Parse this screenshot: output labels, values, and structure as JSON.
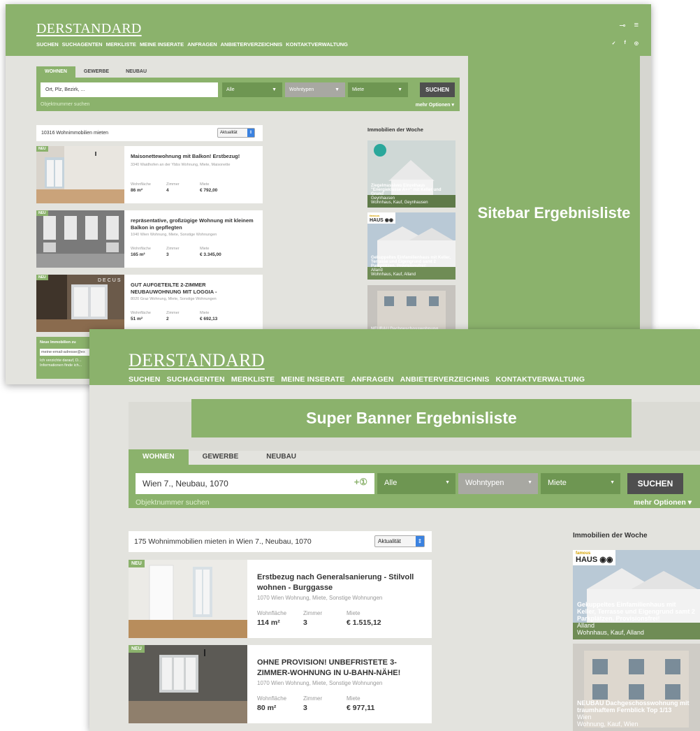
{
  "brand": {
    "logo": "DERSTANDARD",
    "nav": [
      "SUCHEN",
      "SUCHAGENTEN",
      "MERKLISTE",
      "MEINE INSERATE",
      "ANFRAGEN",
      "ANBIETERVERZEICHNIS",
      "KONTAKTVERWALTUNG"
    ],
    "accent": "#8bb26c"
  },
  "shot1": {
    "tabs": [
      "WOHNEN",
      "GEWERBE",
      "NEUBAU"
    ],
    "search_placeholder": "Ort, Plz, Bezirk, ...",
    "filters": [
      "Alle",
      "Wohntypen",
      "Miete"
    ],
    "search_button": "SUCHEN",
    "object_link": "Objektnummer suchen",
    "more_options": "mehr Optionen ▾",
    "count": "10316 Wohnimmobilien mieten",
    "sort": "Aktualität",
    "sitebar_label": "Sitebar Ergebnisliste",
    "right_title": "Immobilien der Woche",
    "listings": [
      {
        "badge": "NEU",
        "title": "Maisonettewohnung mit Balkon! Erstbezug!",
        "sub": "3340 Waidhofen an der Ybbs Wohnung, Miete, Maisonette",
        "area_label": "Wohnfläche",
        "area": "86 m²",
        "rooms_label": "Zimmer",
        "rooms": "4",
        "rent_label": "Miete",
        "rent": "€ 792,00"
      },
      {
        "badge": "NEU",
        "title": "repräsentative, großzügige Wohnung mit kleinem Balkon in gepflegten",
        "sub": "1040 Wien Wohnung, Miete, Sonstige Wohnungen",
        "area_label": "Wohnfläche",
        "area": "165 m²",
        "rooms_label": "Zimmer",
        "rooms": "3",
        "rent_label": "Miete",
        "rent": "€ 3.345,00"
      },
      {
        "badge": "NEU",
        "title": "GUT AUFGETEILTE 2-ZIMMER NEUBAUWOHNUNG MIT LOGGIA -",
        "sub": "8020 Graz Wohnung, Miete, Sonstige Wohnungen",
        "area_label": "Wohnfläche",
        "area": "51 m²",
        "rooms_label": "Zimmer",
        "rooms": "2",
        "rent_label": "Miete",
        "rent": "€ 692,13",
        "thumb_text": "DECUS"
      }
    ],
    "featured": [
      {
        "title": "Ziegelmassives Einzelhaus \"Energieklasse A++\" mit Keller und Grund",
        "loc": "Geynhausen",
        "type": "Wohnhaus, Kauf, Geynhausen"
      },
      {
        "logo": "HAUS",
        "logo_top": "famous",
        "title": "Gekuppeltes Einfamilienhaus mit Keller, Terrasse und Eigengrund samt 2 Parkplätzen. Provisionsfrei!",
        "loc": "Alland",
        "type": "Wohnhaus, Kauf, Alland"
      },
      {
        "title": "NEUBAU Dachgeschosswohnung",
        "loc": "",
        "type": ""
      }
    ],
    "newsletter": {
      "title": "Neue Immobilien zu",
      "email": "meine-email-adresse@ex",
      "consent": "Ich verzichte darauf, D... Informationen finde ich..."
    }
  },
  "shot2": {
    "banner": "Super Banner Ergebnisliste",
    "tabs": [
      "WOHNEN",
      "GEWERBE",
      "NEUBAU"
    ],
    "search_value": "Wien 7., Neubau, 1070",
    "search_plus": "+①",
    "filters": [
      "Alle",
      "Wohntypen",
      "Miete"
    ],
    "search_button": "SUCHEN",
    "object_link": "Objektnummer suchen",
    "more_options": "mehr Optionen ▾",
    "count": "175 Wohnimmobilien mieten in Wien 7., Neubau, 1070",
    "sort": "Aktualität",
    "right_title": "Immobilien der Woche",
    "listings": [
      {
        "badge": "NEU",
        "title": "Erstbezug nach Generalsanierung - Stilvoll wohnen - Burggasse",
        "sub": "1070 Wien Wohnung, Miete, Sonstige Wohnungen",
        "area_label": "Wohnfläche",
        "area": "114 m²",
        "rooms_label": "Zimmer",
        "rooms": "3",
        "rent_label": "Miete",
        "rent": "€ 1.515,12"
      },
      {
        "badge": "NEU",
        "title": "OHNE PROVISION! UNBEFRISTETE 3-ZIMMER-WOHNUNG IN U-BAHN-NÄHE!",
        "sub": "1070 Wien Wohnung, Miete, Sonstige Wohnungen",
        "area_label": "Wohnfläche",
        "area": "80 m²",
        "rooms_label": "Zimmer",
        "rooms": "3",
        "rent_label": "Miete",
        "rent": "€ 977,11"
      }
    ],
    "featured": [
      {
        "logo": "HAUS",
        "logo_top": "famous",
        "title": "Gekuppeltes Einfamilienhaus mit Keller, Terrasse und Eigengrund samt 2 Parkplätzen. Provisionsfrei!",
        "loc": "Alland",
        "type": "Wohnhaus, Kauf, Alland"
      },
      {
        "title": "NEUBAU Dachgeschosswohnung mit traumhaftem Fernblick Top 1/13",
        "loc": "Wien",
        "type": "Wohnung, Kauf, Wien"
      }
    ]
  }
}
